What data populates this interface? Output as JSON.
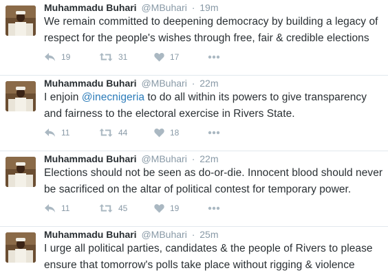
{
  "tweets": [
    {
      "name": "Muhammadu Buhari",
      "handle": "@MBuhari",
      "separator": "·",
      "time": "19m",
      "text_before": "We remain committed to deepening democracy by building a legacy of respect for the people's wishes through free, fair & credible elections",
      "mention": "",
      "text_after": "",
      "replies": "19",
      "retweets": "31",
      "likes": "17"
    },
    {
      "name": "Muhammadu Buhari",
      "handle": "@MBuhari",
      "separator": "·",
      "time": "22m",
      "text_before": "I enjoin ",
      "mention": "@inecnigeria",
      "text_after": " to do all within its powers to give transparency and fairness to the electoral exercise in Rivers State.",
      "replies": "11",
      "retweets": "44",
      "likes": "18"
    },
    {
      "name": "Muhammadu Buhari",
      "handle": "@MBuhari",
      "separator": "·",
      "time": "22m",
      "text_before": "Elections should not be seen as do-or-die. Innocent blood should never be sacrificed on the altar of political contest for temporary power.",
      "mention": "",
      "text_after": "",
      "replies": "11",
      "retweets": "45",
      "likes": "19"
    },
    {
      "name": "Muhammadu Buhari",
      "handle": "@MBuhari",
      "separator": "·",
      "time": "25m",
      "text_before": "I urge all political parties, candidates & the people of Rivers to please ensure that tomorrow's polls take place without rigging & violence",
      "mention": "",
      "text_after": "",
      "replies": "",
      "retweets": "",
      "likes": ""
    }
  ],
  "icons": {
    "reply": "reply-icon",
    "retweet": "retweet-icon",
    "like": "heart-icon",
    "more": "more-icon"
  },
  "colors": {
    "name": "#292f33",
    "muted": "#8899a6",
    "icon": "#aab8c2",
    "mention": "#2b7bb9",
    "divider": "#e1e8ed"
  }
}
